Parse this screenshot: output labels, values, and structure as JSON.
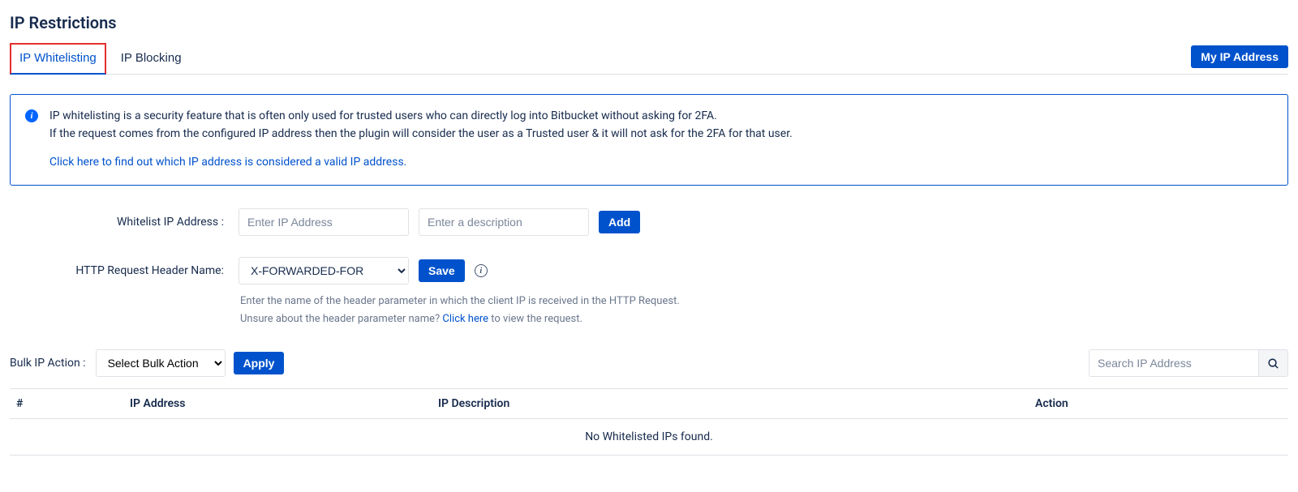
{
  "page_title": "IP Restrictions",
  "tabs": {
    "whitelisting": "IP Whitelisting",
    "blocking": "IP Blocking"
  },
  "header": {
    "my_ip_button": "My IP Address"
  },
  "info": {
    "line1": "IP whitelisting is a security feature that is often only used for trusted users who can directly log into Bitbucket without asking for 2FA.",
    "line2": "If the request comes from the configured IP address then the plugin will consider the user as a Trusted user & it will not ask for the 2FA for that user.",
    "link": "Click here to find out which IP address is considered a valid IP address."
  },
  "form": {
    "whitelist_label": "Whitelist IP Address :",
    "ip_placeholder": "Enter IP Address",
    "desc_placeholder": "Enter a description",
    "add_button": "Add",
    "header_label": "HTTP Request Header Name:",
    "header_value": "X-FORWARDED-FOR",
    "save_button": "Save",
    "help_line1": "Enter the name of the header parameter in which the client IP is received in the HTTP Request.",
    "help_line2_pre": "Unsure about the header parameter name? ",
    "help_link": "Click here",
    "help_line2_post": " to view the request."
  },
  "bulk": {
    "label": "Bulk IP Action :",
    "placeholder": "Select Bulk Action",
    "apply_button": "Apply"
  },
  "search": {
    "placeholder": "Search IP Address"
  },
  "table": {
    "col_num": "#",
    "col_ip": "IP Address",
    "col_desc": "IP Description",
    "col_action": "Action",
    "empty_message": "No Whitelisted IPs found."
  }
}
